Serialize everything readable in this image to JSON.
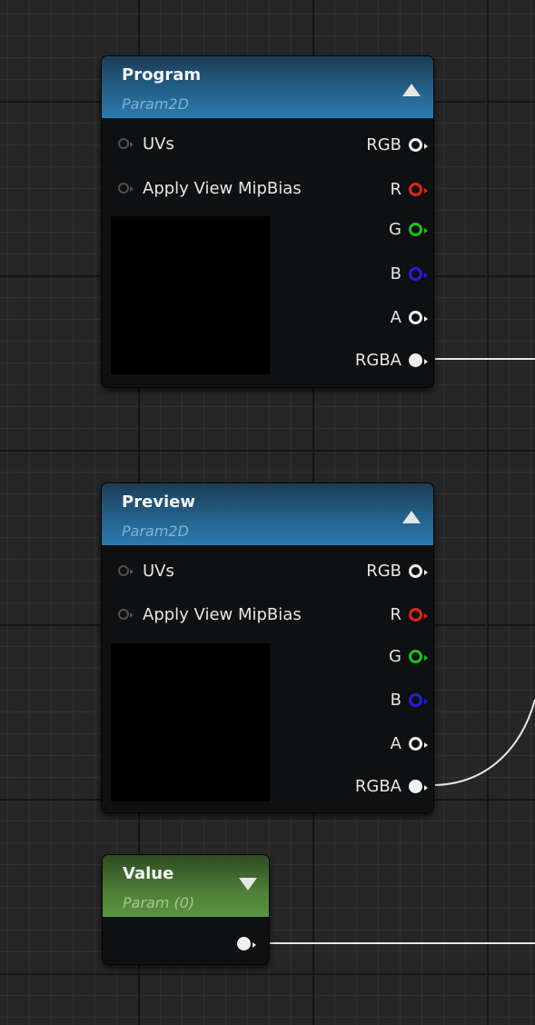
{
  "nodes": [
    {
      "title": "Program",
      "subtitle": "Param2D",
      "inputs": [
        "UVs",
        "Apply View MipBias"
      ],
      "outputs": [
        "RGB",
        "R",
        "G",
        "B",
        "A",
        "RGBA"
      ]
    },
    {
      "title": "Preview",
      "subtitle": "Param2D",
      "inputs": [
        "UVs",
        "Apply View MipBias"
      ],
      "outputs": [
        "RGB",
        "R",
        "G",
        "B",
        "A",
        "RGBA"
      ]
    },
    {
      "title": "Value",
      "subtitle": "Param (0)",
      "inputs": [],
      "outputs": [
        ""
      ]
    }
  ],
  "colors": {
    "param2d_header": "#2c7ab0",
    "param_header": "#5b9540",
    "pin_r": "#e0241c",
    "pin_g": "#1cc21c",
    "pin_b": "#2020d8",
    "pin_white": "#f0f0f0",
    "wire": "#e6e6e6"
  },
  "icons": {
    "collapse_expanded": "triangle-up-icon",
    "collapse_collapsed": "triangle-down-icon",
    "pin": "circle-pin-icon"
  }
}
